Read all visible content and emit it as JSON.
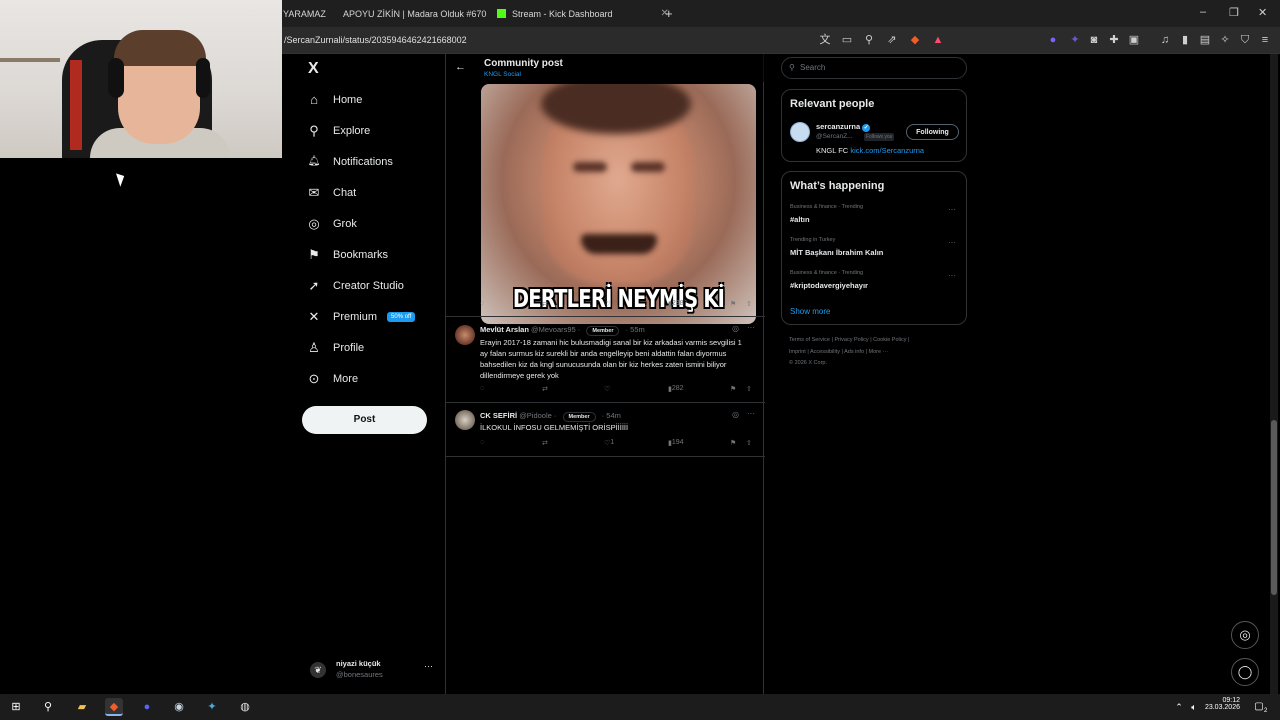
{
  "browser": {
    "tabs": [
      {
        "label": "YARAMAZ",
        "icon": "tab-favicon"
      },
      {
        "label": "APOYU ZİKİN | Madara Olduk #670 -",
        "icon": "youtube-icon"
      },
      {
        "label": "Stream - Kick Dashboard",
        "icon": "kick-icon"
      }
    ],
    "new_tab": "+",
    "url": "/SercanZurnali/status/2035946462421668002",
    "window_controls": [
      "–",
      "❐",
      "✕"
    ]
  },
  "nav": {
    "logo": "X",
    "items": [
      {
        "label": "Home",
        "icon": "home-icon",
        "glyph": "⌂"
      },
      {
        "label": "Explore",
        "icon": "search-icon",
        "glyph": "⚲"
      },
      {
        "label": "Notifications",
        "icon": "bell-icon",
        "glyph": "🔔︎"
      },
      {
        "label": "Chat",
        "icon": "mail-icon",
        "glyph": "✉"
      },
      {
        "label": "Grok",
        "icon": "grok-icon",
        "glyph": "◎"
      },
      {
        "label": "Bookmarks",
        "icon": "bookmark-icon",
        "glyph": "⚑"
      },
      {
        "label": "Creator Studio",
        "icon": "rocket-icon",
        "glyph": "➚"
      },
      {
        "label": "Premium",
        "icon": "x-premium-icon",
        "glyph": "✕"
      },
      {
        "label": "Profile",
        "icon": "person-icon",
        "glyph": "♙"
      },
      {
        "label": "More",
        "icon": "more-circle-icon",
        "glyph": "⊙"
      }
    ],
    "premium_badge": "50% off",
    "post_button": "Post",
    "account": {
      "name": "niyazi küçük",
      "handle": "@bonesaures",
      "more": "···"
    }
  },
  "main": {
    "header": {
      "title": "Community post",
      "subtitle": "KNGL Social"
    },
    "meme_caption": "DERTLERİ NEYMİŞ Kİ",
    "post_actions": {
      "views": "238"
    },
    "replies": [
      {
        "name": "Mevlüt Arslan",
        "handle": "@Mevoars95 ·",
        "badge": "Member",
        "time": "· 55m",
        "text": "Erayin 2017-18 zamani hic bulusmadigi sanal bir kiz arkadasi varmis sevgilisi 1 ay falan surmus kiz surekli bir anda engelleyip beni aldattin falan diyormus bahsedilen kiz da kngl sunucusunda olan bir kiz herkes zaten ismini biliyor dillendirmeye gerek yok",
        "views": "282",
        "likes": ""
      },
      {
        "name": "CK SEFİRİ",
        "handle": "@Pidoole ·",
        "badge": "Member",
        "time": "· 54m",
        "text": "İLKOKUL İNFOSU GELMEMİŞTİ ORİSPİİİİİİ",
        "views": "194",
        "likes": "1"
      }
    ]
  },
  "sidebar": {
    "search_placeholder": "Search",
    "relevant": {
      "title": "Relevant people",
      "name": "sercanzurna",
      "handle": "@SercanZ...",
      "follows_you": "Follows you",
      "follow_button": "Following",
      "bio_prefix": "KNGL FC",
      "bio_link": "kick.com/Sercanzurna"
    },
    "happening": {
      "title": "What’s happening",
      "trends": [
        {
          "category": "Business & finance · Trending",
          "name": "#altın"
        },
        {
          "category": "Trending in Turkey",
          "name": "MİT Başkanı İbrahim Kalın"
        },
        {
          "category": "Business & finance · Trending",
          "name": "#kriptodavergiyehayır"
        }
      ],
      "show_more": "Show more"
    },
    "footer_line1": "Terms of Service  |  Privacy Policy  |  Cookie Policy  |",
    "footer_line2": "Imprint  |  Accessibility  |  Ads info  |  More ···",
    "footer_line3": "© 2026 X Corp."
  },
  "taskbar": {
    "time": "09:12",
    "date": "23.03.2026",
    "notification_count": "2"
  },
  "colors": {
    "accent": "#1d9bf0",
    "background": "#000000",
    "border": "#2f3336",
    "muted": "#71767b"
  }
}
